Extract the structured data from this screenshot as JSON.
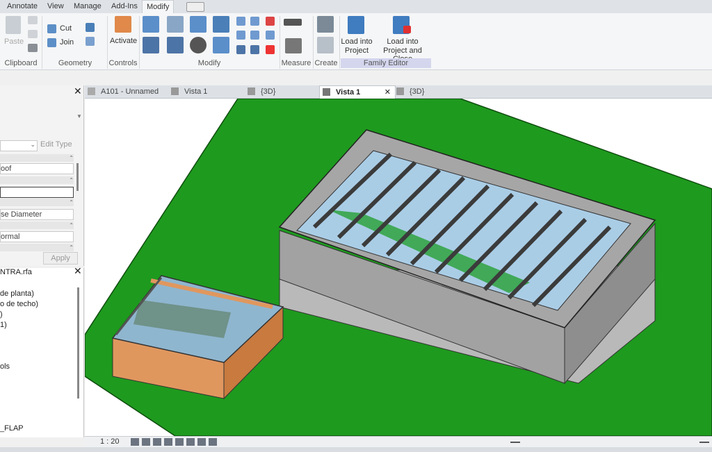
{
  "menu": {
    "tabs": [
      "Annotate",
      "View",
      "Manage",
      "Add-Ins",
      "Modify"
    ],
    "active": "Modify"
  },
  "ribbon": {
    "clipboard": {
      "paste": "Paste",
      "panel": "Clipboard"
    },
    "geometry": {
      "cut": "Cut",
      "join": "Join",
      "panel": "Geometry"
    },
    "controls": {
      "activate": "Activate",
      "panel": "Controls"
    },
    "modify": {
      "panel": "Modify"
    },
    "measure": {
      "panel": "Measure"
    },
    "create": {
      "panel": "Create"
    },
    "family_editor": {
      "panel": "Family Editor",
      "load_into_project_line1": "Load into",
      "load_into_project_line2": "Project",
      "load_close_line1": "Load into",
      "load_close_line2": "Project and Close"
    }
  },
  "properties": {
    "edit_type": "Edit Type",
    "row1": "oof",
    "row3": "se Diameter",
    "row4": "ormal",
    "apply": "Apply"
  },
  "browser": {
    "title": "NTRA.rfa",
    "items": [
      "de planta)",
      "o de techo)",
      ")",
      "1)",
      "ols",
      "_FLAP"
    ]
  },
  "view_tabs": [
    {
      "label": "A101 - Unnamed",
      "icon": "sheet-icon"
    },
    {
      "label": "Vista 1",
      "icon": "3d-view-icon"
    },
    {
      "label": "{3D}",
      "icon": "3d-view-icon"
    },
    {
      "label": "Vista 1",
      "icon": "3d-view-icon",
      "active": true
    },
    {
      "label": "{3D}",
      "icon": "3d-view-icon"
    }
  ],
  "status": {
    "scale": "1 : 20"
  },
  "colors": {
    "ground": "#1e9a1e",
    "frame": "#9a9a9a",
    "glass": "#aacde6",
    "wood": "#e0975e"
  }
}
